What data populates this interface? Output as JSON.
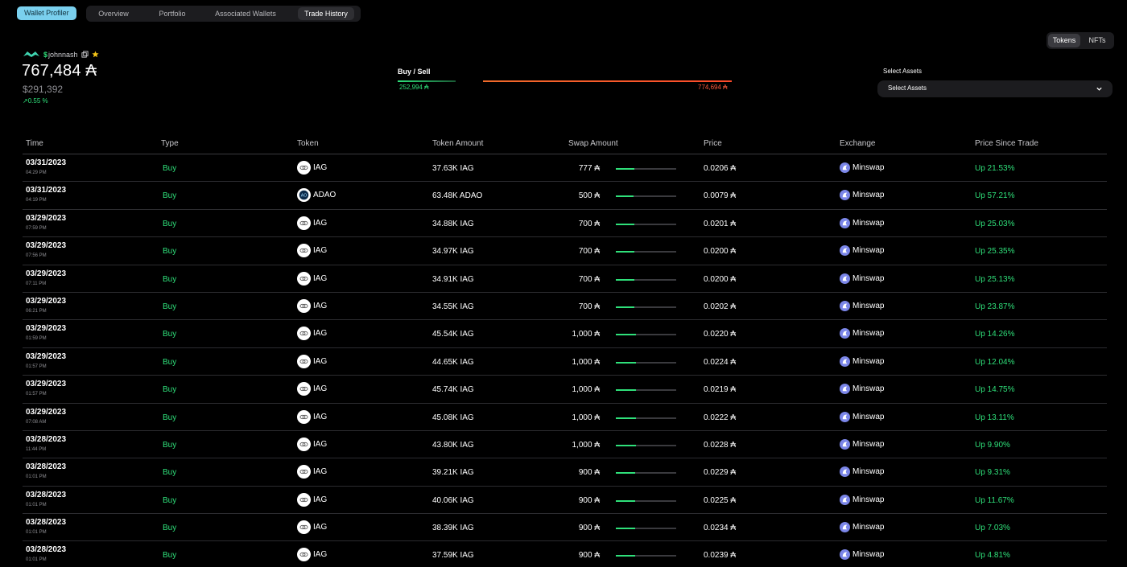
{
  "nav": {
    "brand_button": "Wallet Profiler",
    "tabs": [
      {
        "label": "Overview"
      },
      {
        "label": "Portfolio"
      },
      {
        "label": "Associated Wallets"
      },
      {
        "label": "Trade History",
        "active": true
      }
    ]
  },
  "asset_toggle": {
    "tokens": "Tokens",
    "nfts": "NFTs",
    "active": "Tokens"
  },
  "wallet": {
    "handle_symbol": "$",
    "handle": "johnnash",
    "balance": "767,484 ₳",
    "usd_value": "$291,392",
    "change": "↗0.55 %"
  },
  "buy_sell": {
    "label": "Buy / Sell",
    "buy_value": "252,994 ₳",
    "sell_value": "774,694 ₳"
  },
  "select_assets": {
    "label": "Select Assets",
    "value": "Select Assets"
  },
  "table": {
    "headers": [
      "Time",
      "Type",
      "Token",
      "Token Amount",
      "Swap Amount",
      "Price",
      "Exchange",
      "Price Since Trade"
    ],
    "rows": [
      {
        "date": "03/31/2023",
        "time": "04:29 PM",
        "type": "Buy",
        "token": "IAG",
        "token_amount": "37.63K IAG",
        "swap": "777 ₳",
        "swap_level": 0.31,
        "price": "0.0206 ₳",
        "exchange": "Minswap",
        "since": "Up 21.53%"
      },
      {
        "date": "03/31/2023",
        "time": "04:19 PM",
        "type": "Buy",
        "token": "ADAO",
        "token_amount": "63.48K ADAO",
        "swap": "500 ₳",
        "swap_level": 0.29,
        "price": "0.0079 ₳",
        "exchange": "Minswap",
        "since": "Up 57.21%"
      },
      {
        "date": "03/29/2023",
        "time": "07:59 PM",
        "type": "Buy",
        "token": "IAG",
        "token_amount": "34.88K IAG",
        "swap": "700 ₳",
        "swap_level": 0.31,
        "price": "0.0201 ₳",
        "exchange": "Minswap",
        "since": "Up 25.03%"
      },
      {
        "date": "03/29/2023",
        "time": "07:56 PM",
        "type": "Buy",
        "token": "IAG",
        "token_amount": "34.97K IAG",
        "swap": "700 ₳",
        "swap_level": 0.31,
        "price": "0.0200 ₳",
        "exchange": "Minswap",
        "since": "Up 25.35%"
      },
      {
        "date": "03/29/2023",
        "time": "07:11 PM",
        "type": "Buy",
        "token": "IAG",
        "token_amount": "34.91K IAG",
        "swap": "700 ₳",
        "swap_level": 0.31,
        "price": "0.0200 ₳",
        "exchange": "Minswap",
        "since": "Up 25.13%"
      },
      {
        "date": "03/29/2023",
        "time": "06:21 PM",
        "type": "Buy",
        "token": "IAG",
        "token_amount": "34.55K IAG",
        "swap": "700 ₳",
        "swap_level": 0.31,
        "price": "0.0202 ₳",
        "exchange": "Minswap",
        "since": "Up 23.87%"
      },
      {
        "date": "03/29/2023",
        "time": "01:59 PM",
        "type": "Buy",
        "token": "IAG",
        "token_amount": "45.54K IAG",
        "swap": "1,000 ₳",
        "swap_level": 0.33,
        "price": "0.0220 ₳",
        "exchange": "Minswap",
        "since": "Up 14.26%"
      },
      {
        "date": "03/29/2023",
        "time": "01:57 PM",
        "type": "Buy",
        "token": "IAG",
        "token_amount": "44.65K IAG",
        "swap": "1,000 ₳",
        "swap_level": 0.33,
        "price": "0.0224 ₳",
        "exchange": "Minswap",
        "since": "Up 12.04%"
      },
      {
        "date": "03/29/2023",
        "time": "01:57 PM",
        "type": "Buy",
        "token": "IAG",
        "token_amount": "45.74K IAG",
        "swap": "1,000 ₳",
        "swap_level": 0.33,
        "price": "0.0219 ₳",
        "exchange": "Minswap",
        "since": "Up 14.75%"
      },
      {
        "date": "03/29/2023",
        "time": "07:08 AM",
        "type": "Buy",
        "token": "IAG",
        "token_amount": "45.08K IAG",
        "swap": "1,000 ₳",
        "swap_level": 0.33,
        "price": "0.0222 ₳",
        "exchange": "Minswap",
        "since": "Up 13.11%"
      },
      {
        "date": "03/28/2023",
        "time": "11:44 PM",
        "type": "Buy",
        "token": "IAG",
        "token_amount": "43.80K IAG",
        "swap": "1,000 ₳",
        "swap_level": 0.33,
        "price": "0.0228 ₳",
        "exchange": "Minswap",
        "since": "Up 9.90%"
      },
      {
        "date": "03/28/2023",
        "time": "01:01 PM",
        "type": "Buy",
        "token": "IAG",
        "token_amount": "39.21K IAG",
        "swap": "900 ₳",
        "swap_level": 0.32,
        "price": "0.0229 ₳",
        "exchange": "Minswap",
        "since": "Up 9.31%"
      },
      {
        "date": "03/28/2023",
        "time": "01:01 PM",
        "type": "Buy",
        "token": "IAG",
        "token_amount": "40.06K IAG",
        "swap": "900 ₳",
        "swap_level": 0.32,
        "price": "0.0225 ₳",
        "exchange": "Minswap",
        "since": "Up 11.67%"
      },
      {
        "date": "03/28/2023",
        "time": "01:01 PM",
        "type": "Buy",
        "token": "IAG",
        "token_amount": "38.39K IAG",
        "swap": "900 ₳",
        "swap_level": 0.32,
        "price": "0.0234 ₳",
        "exchange": "Minswap",
        "since": "Up 7.03%"
      },
      {
        "date": "03/28/2023",
        "time": "01:01 PM",
        "type": "Buy",
        "token": "IAG",
        "token_amount": "37.59K IAG",
        "swap": "900 ₳",
        "swap_level": 0.32,
        "price": "0.0239 ₳",
        "exchange": "Minswap",
        "since": "Up 4.81%"
      }
    ]
  },
  "colors": {
    "accent_green": "#2fe07a",
    "sell_red": "#ff5a3c",
    "brand_blue": "#7ad0ee"
  },
  "icons": [
    "wallet-logo-icon",
    "copy-icon",
    "star-icon",
    "chevron-down-icon",
    "token-iag-icon",
    "token-adao-icon",
    "minswap-icon"
  ]
}
